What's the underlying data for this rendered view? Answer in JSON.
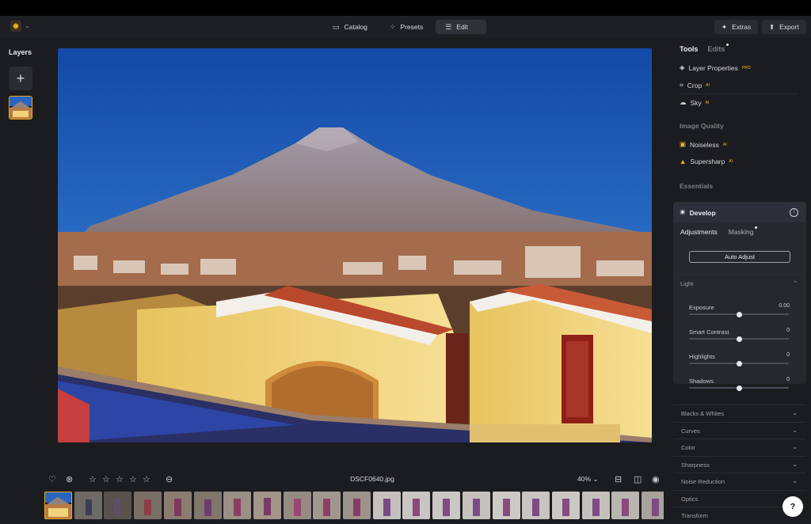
{
  "app": {
    "logo_icon": "luminar-sun-icon"
  },
  "topbar": {
    "tabs": [
      {
        "label": "Catalog",
        "icon": "folder-icon"
      },
      {
        "label": "Presets",
        "icon": "presets-icon"
      },
      {
        "label": "Edit",
        "icon": "sliders-icon",
        "active": true
      }
    ],
    "extras_label": "Extras",
    "export_label": "Export"
  },
  "layers": {
    "title": "Layers"
  },
  "photo": {
    "filename": "DSCF0640.jpg",
    "zoom": "40%"
  },
  "right_panel": {
    "tabs": {
      "tools": "Tools",
      "edits": "Edits"
    },
    "tools": [
      {
        "label": "Layer Properties",
        "badge": "PRO",
        "icon": "layers-icon"
      },
      {
        "label": "Crop",
        "badge": "AI",
        "icon": "crop-icon"
      },
      {
        "label": "Sky",
        "badge": "AI",
        "icon": "cloud-icon"
      }
    ],
    "image_quality": {
      "title": "Image Quality",
      "items": [
        {
          "label": "Noiseless",
          "badge": "AI"
        },
        {
          "label": "Supersharp",
          "badge": "AI"
        }
      ]
    },
    "essentials_title": "Essentials",
    "develop": {
      "title": "Develop",
      "subtabs": {
        "adjustments": "Adjustments",
        "masking": "Masking"
      },
      "auto_adjust": "Auto Adjust",
      "light": {
        "title": "Light",
        "sliders": [
          {
            "label": "Exposure",
            "value": "0.00",
            "level": 0.5
          },
          {
            "label": "Smart Contrast",
            "value": "0",
            "level": 0.5
          },
          {
            "label": "Highlights",
            "value": "0",
            "level": 0.5
          },
          {
            "label": "Shadows",
            "value": "0",
            "level": 0.5
          }
        ]
      }
    },
    "collapsed_sections": [
      "Blacks & Whites",
      "Curves",
      "Color",
      "Sharpness",
      "Noise Reduction",
      "Optics",
      "Transform"
    ]
  },
  "colors": {
    "accent": "#e9a81c",
    "panel_bg": "#1b1c20",
    "sky": "#1a5bb8"
  }
}
